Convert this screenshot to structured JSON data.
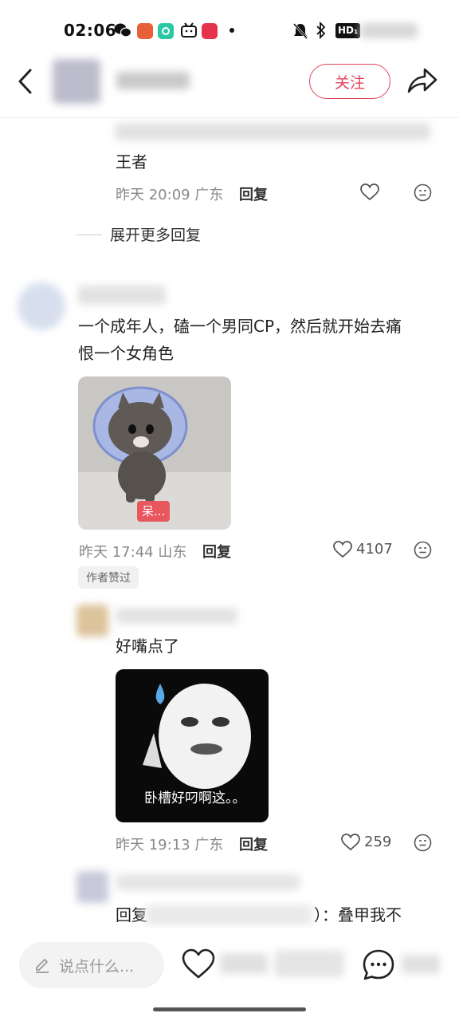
{
  "status_bar": {
    "time": "02:06",
    "status_icons": [
      "wechat-icon",
      "game-icon",
      "app-icon",
      "bilibili-icon",
      "xiaohongshu-icon",
      "notification-dot-icon"
    ],
    "right_icons": [
      "mute-bell-icon",
      "bluetooth-icon",
      "hd-icon",
      "battery-icon"
    ],
    "hd_label": "HD₁"
  },
  "header": {
    "follow_label": "关注"
  },
  "comments": [
    {
      "text": "王者",
      "meta": "昨天 20:09 广东",
      "reply_label": "回复"
    },
    {
      "expand_label": "展开更多回复"
    },
    {
      "text_line1": "一个成年人，磕一个男同CP，然后就开始去痛",
      "text_line2": "恨一个女角色",
      "image_caption": "呆...",
      "meta": "昨天 17:44 山东",
      "reply_label": "回复",
      "likes": "4107",
      "author_badge": "作者赞过"
    },
    {
      "text": "好嘴点了",
      "image_caption": "卧槽好叼啊这。。",
      "meta": "昨天 19:13 广东",
      "reply_label": "回复",
      "likes": "259"
    },
    {
      "text_start": "回复",
      "text_end": "）：叠甲我不"
    }
  ],
  "bottom_bar": {
    "comment_placeholder": "说点什么...",
    "icons": [
      "pencil-icon",
      "heart-icon",
      "comment-icon"
    ]
  },
  "colors": {
    "accent": "#e2455c",
    "text": "#222222",
    "meta": "#888888"
  }
}
